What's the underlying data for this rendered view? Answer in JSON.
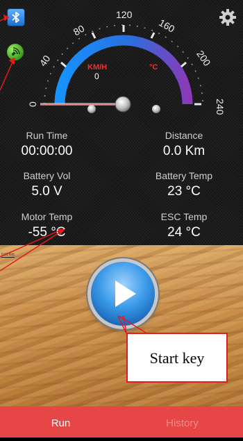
{
  "gauge": {
    "ticks": [
      "0",
      "40",
      "80",
      "120",
      "160",
      "200",
      "240"
    ],
    "speed_unit": "KM/H",
    "speed_value": "0",
    "temp_unit": "°C"
  },
  "stats": {
    "run_time": {
      "label": "Run Time",
      "value": "00:00:00"
    },
    "distance": {
      "label": "Distance",
      "value": "0.0 Km"
    },
    "battery_vol": {
      "label": "Battery Vol",
      "value": "5.0 V"
    },
    "battery_temp": {
      "label": "Battery Temp",
      "value": "23 °C"
    },
    "motor_temp": {
      "label": "Motor Temp",
      "value": "-55 °C"
    },
    "esc_temp": {
      "label": "ESC Temp",
      "value": "24 °C"
    }
  },
  "map": {
    "scale_label": "0.01 Km"
  },
  "callout": {
    "text": "Start key"
  },
  "tabs": {
    "run": "Run",
    "history": "History"
  },
  "colors": {
    "accent_red": "#e64646",
    "gauge_blue": "#1e8be8",
    "gauge_purple": "#7a3ab0"
  },
  "icons": {
    "bluetooth": "bluetooth-icon",
    "signal": "signal-icon",
    "settings": "gear-icon",
    "play": "play-icon"
  }
}
